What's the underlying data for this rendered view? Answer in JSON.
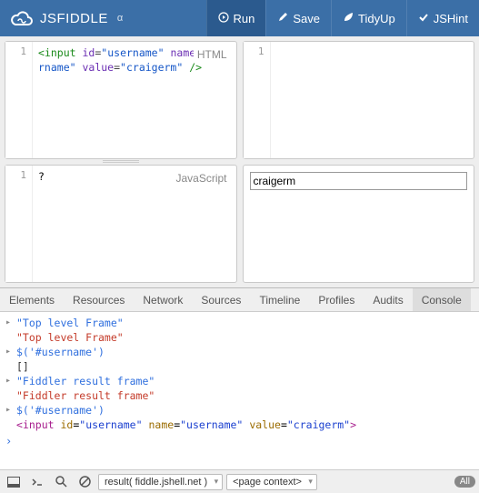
{
  "header": {
    "brand": "JSFIDDLE",
    "alpha": "α",
    "buttons": {
      "run": "Run",
      "save": "Save",
      "tidy": "TidyUp",
      "jshint": "JSHint"
    }
  },
  "panes": {
    "html": {
      "label": "HTML",
      "line": "1",
      "code": {
        "t1": "<",
        "t2": "input",
        "t3": " ",
        "t4": "id",
        "t5": "=",
        "t6": "\"username\"",
        "t7": " ",
        "t8": "name",
        "t9": "=",
        "t10": "\"username\"",
        "t11": " ",
        "t12": "value",
        "t13": "=",
        "t14": "\"craigerm\"",
        "t15": " />"
      }
    },
    "css": {
      "line": "1"
    },
    "js": {
      "label": "JavaScript",
      "line": "1",
      "code": "?"
    },
    "result": {
      "value": "craigerm"
    }
  },
  "devtools": {
    "tabs": {
      "elements": "Elements",
      "resources": "Resources",
      "network": "Network",
      "sources": "Sources",
      "timeline": "Timeline",
      "profiles": "Profiles",
      "audits": "Audits",
      "console": "Console"
    },
    "console": {
      "l1": "\"Top level Frame\"",
      "l2": "\"Top level Frame\"",
      "l3": "$('#username')",
      "l4": "[]",
      "l5": "\"Fiddler result frame\"",
      "l6": "\"Fiddler result frame\"",
      "l7": "$('#username')",
      "l8": {
        "a": "<",
        "b": "input",
        "c": " ",
        "d": "id",
        "e": "=",
        "f": "\"username\"",
        "g": " ",
        "h": "name",
        "i": "=",
        "j": "\"username\"",
        "k": " ",
        "l": "value",
        "m": "=",
        "n": "\"craigerm\"",
        "o": ">"
      }
    }
  },
  "status": {
    "frame": "result( fiddle.jshell.net )",
    "context": "<page context>",
    "badge": "All"
  }
}
